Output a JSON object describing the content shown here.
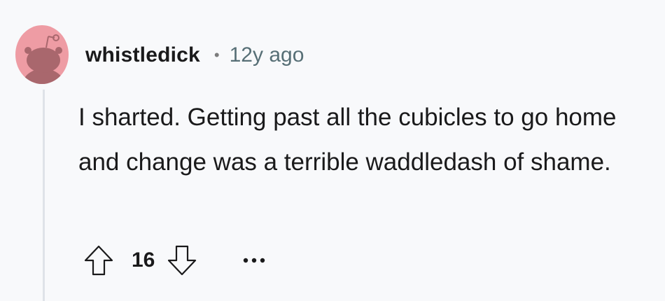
{
  "comment": {
    "author": "whistledick",
    "separator": "•",
    "age": "12y ago",
    "body": "I sharted. Getting past all the cubicles to go home and change was a terrible waddledash of shame.",
    "score": "16"
  },
  "icons": {
    "avatar": "snoo-avatar-icon",
    "upvote": "arrow-up-icon",
    "downvote": "arrow-down-icon",
    "more": "more-options-icon"
  },
  "colors": {
    "background": "#f8f9fb",
    "avatar_bg": "#ee9ca4",
    "avatar_figure": "#a9676d",
    "text": "#1a1a1b",
    "muted": "#576f76",
    "thread_line": "#dfe3e8"
  }
}
